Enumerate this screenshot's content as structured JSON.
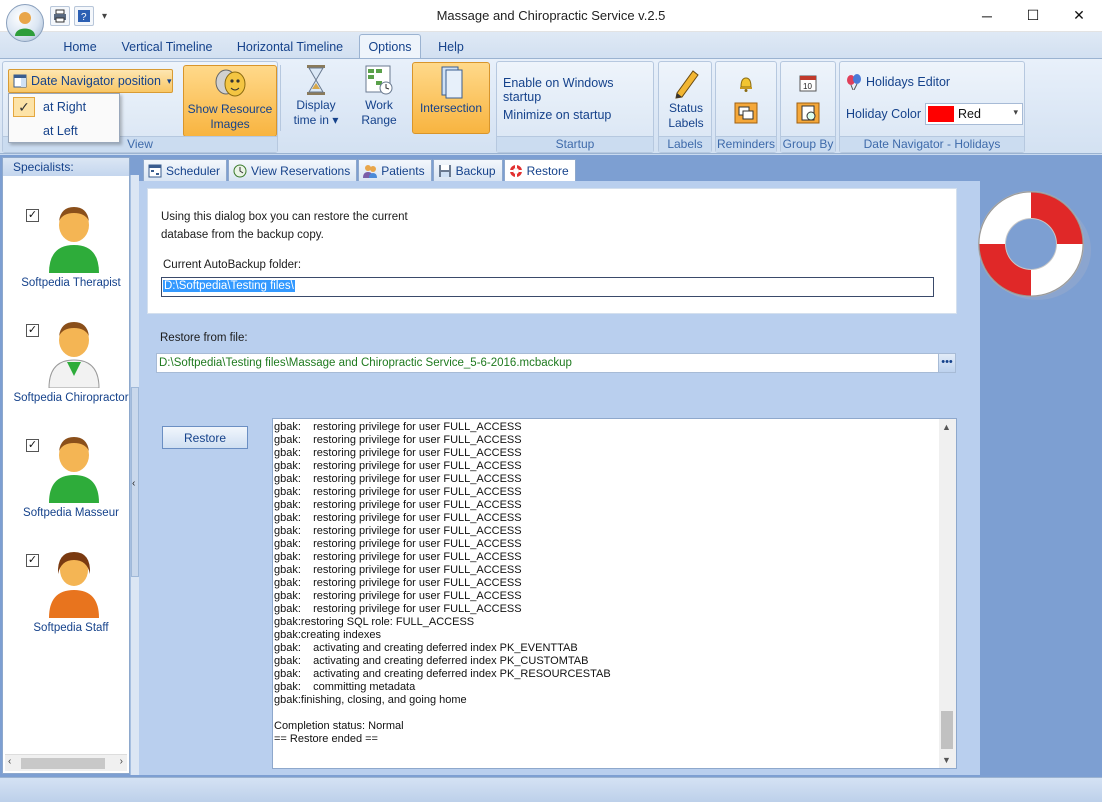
{
  "window": {
    "title": "Massage and Chiropractic Service v.2.5",
    "minimize_glyph": "─",
    "maximize_glyph": "☐",
    "close_glyph": "✕"
  },
  "quick_access": {
    "dropdown_glyph": "▾"
  },
  "ribbon_tabs": [
    "Home",
    "Vertical Timeline",
    "Horizontal Timeline",
    "Options",
    "Help"
  ],
  "ribbon": {
    "date_nav_button": "Date Navigator position",
    "date_nav_options": [
      "at Right",
      "at Left"
    ],
    "date_nav_selected": "at Right",
    "show_resource_images": "Show Resource Images",
    "display_time_in": "Display time in",
    "work_range": "Work Range",
    "intersection": "Intersection",
    "view_group": "View",
    "enable_startup": "Enable on Windows startup",
    "minimize_startup": "Minimize on startup",
    "startup_group": "Startup",
    "status_labels": "Status Labels",
    "labels_group": "Labels",
    "reminders_group": "Reminders",
    "group_by_group": "Group By",
    "holidays_editor": "Holidays Editor",
    "holiday_color_label": "Holiday Color",
    "holiday_color_value": "Red",
    "holiday_color_swatch": "#ff0000",
    "date_nav_holidays_group": "Date Navigator - Holidays"
  },
  "specialists": {
    "header": "Specialists:",
    "items": [
      {
        "name": "Softpedia Therapist",
        "checked": true
      },
      {
        "name": "Softpedia Chiropractor",
        "checked": true
      },
      {
        "name": "Softpedia Masseur",
        "checked": true
      },
      {
        "name": "Softpedia Staff",
        "checked": true
      }
    ]
  },
  "page_tabs": [
    "Scheduler",
    "View Reservations",
    "Patients",
    "Backup",
    "Restore"
  ],
  "active_page_tab": "Restore",
  "restore": {
    "intro_line1": "Using this dialog box you can restore the current",
    "intro_line2": "database from the backup copy.",
    "autobackup_label": "Current AutoBackup folder:",
    "autobackup_value": "D:\\Softpedia\\Testing files\\",
    "restore_from_label": "Restore from file:",
    "restore_from_value": "D:\\Softpedia\\Testing files\\Massage and Chiropractic Service_5-6-2016.mcbackup",
    "ellipsis": "•••",
    "restore_button": "Restore",
    "log_lines": [
      "gbak:    restoring privilege for user FULL_ACCESS",
      "gbak:    restoring privilege for user FULL_ACCESS",
      "gbak:    restoring privilege for user FULL_ACCESS",
      "gbak:    restoring privilege for user FULL_ACCESS",
      "gbak:    restoring privilege for user FULL_ACCESS",
      "gbak:    restoring privilege for user FULL_ACCESS",
      "gbak:    restoring privilege for user FULL_ACCESS",
      "gbak:    restoring privilege for user FULL_ACCESS",
      "gbak:    restoring privilege for user FULL_ACCESS",
      "gbak:    restoring privilege for user FULL_ACCESS",
      "gbak:    restoring privilege for user FULL_ACCESS",
      "gbak:    restoring privilege for user FULL_ACCESS",
      "gbak:    restoring privilege for user FULL_ACCESS",
      "gbak:    restoring privilege for user FULL_ACCESS",
      "gbak:    restoring privilege for user FULL_ACCESS",
      "gbak:restoring SQL role: FULL_ACCESS",
      "gbak:creating indexes",
      "gbak:    activating and creating deferred index PK_EVENTTAB",
      "gbak:    activating and creating deferred index PK_CUSTOMTAB",
      "gbak:    activating and creating deferred index PK_RESOURCESTAB",
      "gbak:    committing metadata",
      "gbak:finishing, closing, and going home",
      "",
      "Completion status: Normal",
      "== Restore ended =="
    ]
  }
}
